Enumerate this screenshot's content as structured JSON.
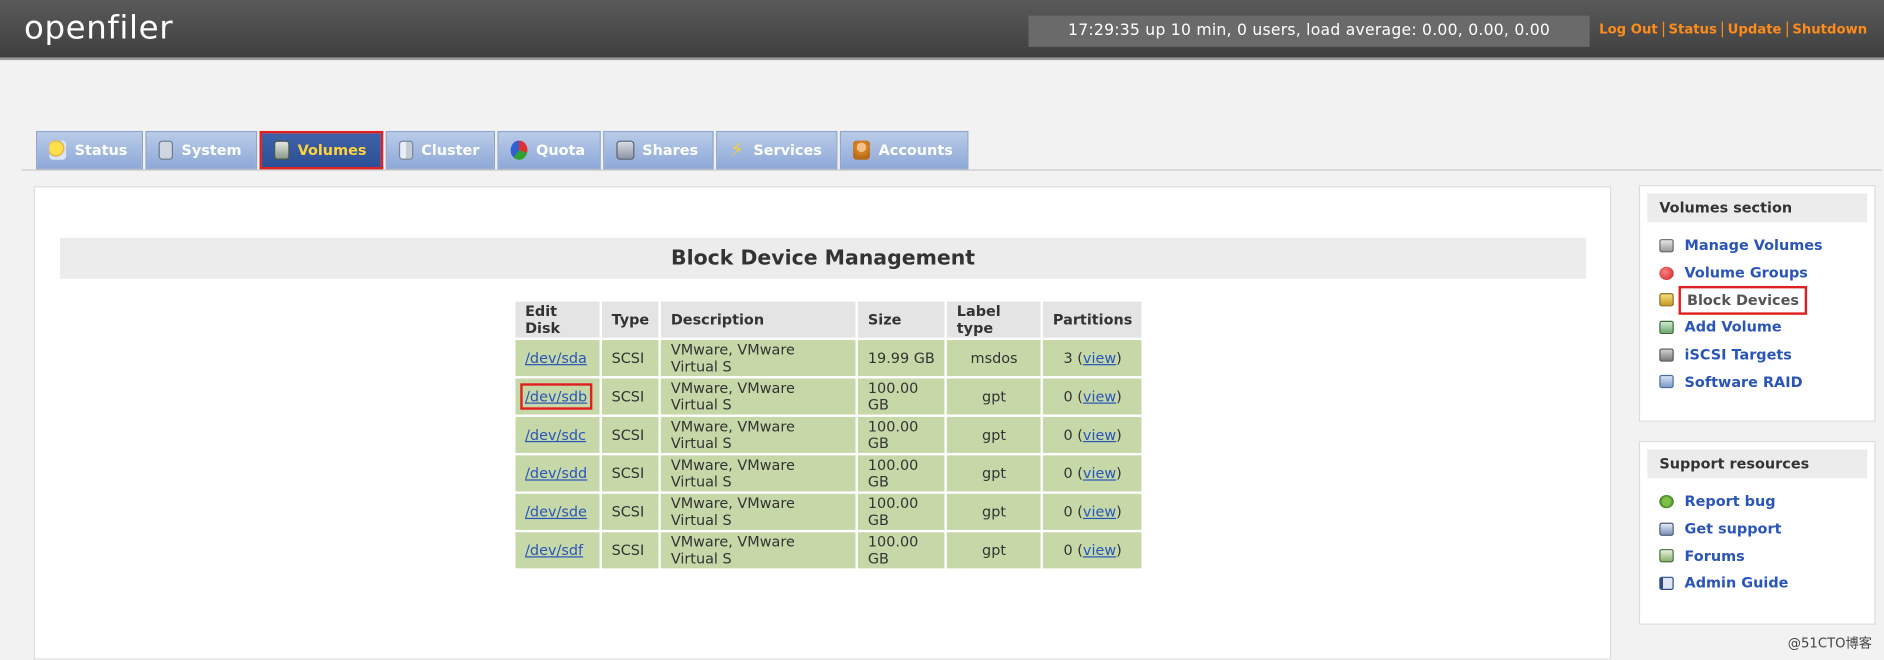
{
  "header": {
    "logo": "openfiler",
    "uptime": "17:29:35 up 10 min, 0 users, load average: 0.00, 0.00, 0.00",
    "links": [
      "Log Out",
      "Status",
      "Update",
      "Shutdown"
    ]
  },
  "tabs": [
    {
      "label": "Status",
      "icon": "weather-icon",
      "active": false
    },
    {
      "label": "System",
      "icon": "monitor-icon",
      "active": false
    },
    {
      "label": "Volumes",
      "icon": "disk-icon",
      "active": true
    },
    {
      "label": "Cluster",
      "icon": "cluster-icon",
      "active": false
    },
    {
      "label": "Quota",
      "icon": "pie-icon",
      "active": false
    },
    {
      "label": "Shares",
      "icon": "share-icon",
      "active": false
    },
    {
      "label": "Services",
      "icon": "lightning-icon",
      "active": false
    },
    {
      "label": "Accounts",
      "icon": "user-icon",
      "active": false
    }
  ],
  "main": {
    "title": "Block Device Management",
    "columns": [
      "Edit Disk",
      "Type",
      "Description",
      "Size",
      "Label type",
      "Partitions"
    ],
    "rows": [
      {
        "disk": "/dev/sda",
        "type": "SCSI",
        "description": "VMware, VMware Virtual S",
        "size": "19.99 GB",
        "label": "msdos",
        "partitions": "3",
        "view": "view"
      },
      {
        "disk": "/dev/sdb",
        "type": "SCSI",
        "description": "VMware, VMware Virtual S",
        "size": "100.00 GB",
        "label": "gpt",
        "partitions": "0",
        "view": "view"
      },
      {
        "disk": "/dev/sdc",
        "type": "SCSI",
        "description": "VMware, VMware Virtual S",
        "size": "100.00 GB",
        "label": "gpt",
        "partitions": "0",
        "view": "view"
      },
      {
        "disk": "/dev/sdd",
        "type": "SCSI",
        "description": "VMware, VMware Virtual S",
        "size": "100.00 GB",
        "label": "gpt",
        "partitions": "0",
        "view": "view"
      },
      {
        "disk": "/dev/sde",
        "type": "SCSI",
        "description": "VMware, VMware Virtual S",
        "size": "100.00 GB",
        "label": "gpt",
        "partitions": "0",
        "view": "view"
      },
      {
        "disk": "/dev/sdf",
        "type": "SCSI",
        "description": "VMware, VMware Virtual S",
        "size": "100.00 GB",
        "label": "gpt",
        "partitions": "0",
        "view": "view"
      }
    ]
  },
  "sidebar": {
    "volumes_section": {
      "title": "Volumes section",
      "items": [
        {
          "label": "Manage Volumes",
          "icon": "drive-icon"
        },
        {
          "label": "Volume Groups",
          "icon": "group-icon"
        },
        {
          "label": "Block Devices",
          "icon": "block-device-icon"
        },
        {
          "label": "Add Volume",
          "icon": "add-volume-icon"
        },
        {
          "label": "iSCSI Targets",
          "icon": "iscsi-icon"
        },
        {
          "label": "Software RAID",
          "icon": "raid-icon"
        }
      ]
    },
    "support": {
      "title": "Support resources",
      "items": [
        {
          "label": "Report bug",
          "icon": "bug-icon"
        },
        {
          "label": "Get support",
          "icon": "support-icon"
        },
        {
          "label": "Forums",
          "icon": "forum-icon"
        },
        {
          "label": "Admin Guide",
          "icon": "book-icon"
        }
      ]
    }
  },
  "watermark": "@51CTO博客",
  "colors": {
    "header_bg": "#4a4a4a",
    "link_orange": "#ff8c1a",
    "tab_bg": "#9db4de",
    "tab_active_bg": "#3559a0",
    "tab_active_text": "#ffd43b",
    "row_green": "#c6d8a8",
    "link_blue": "#2a55b8",
    "highlight_red": "#e02020"
  }
}
